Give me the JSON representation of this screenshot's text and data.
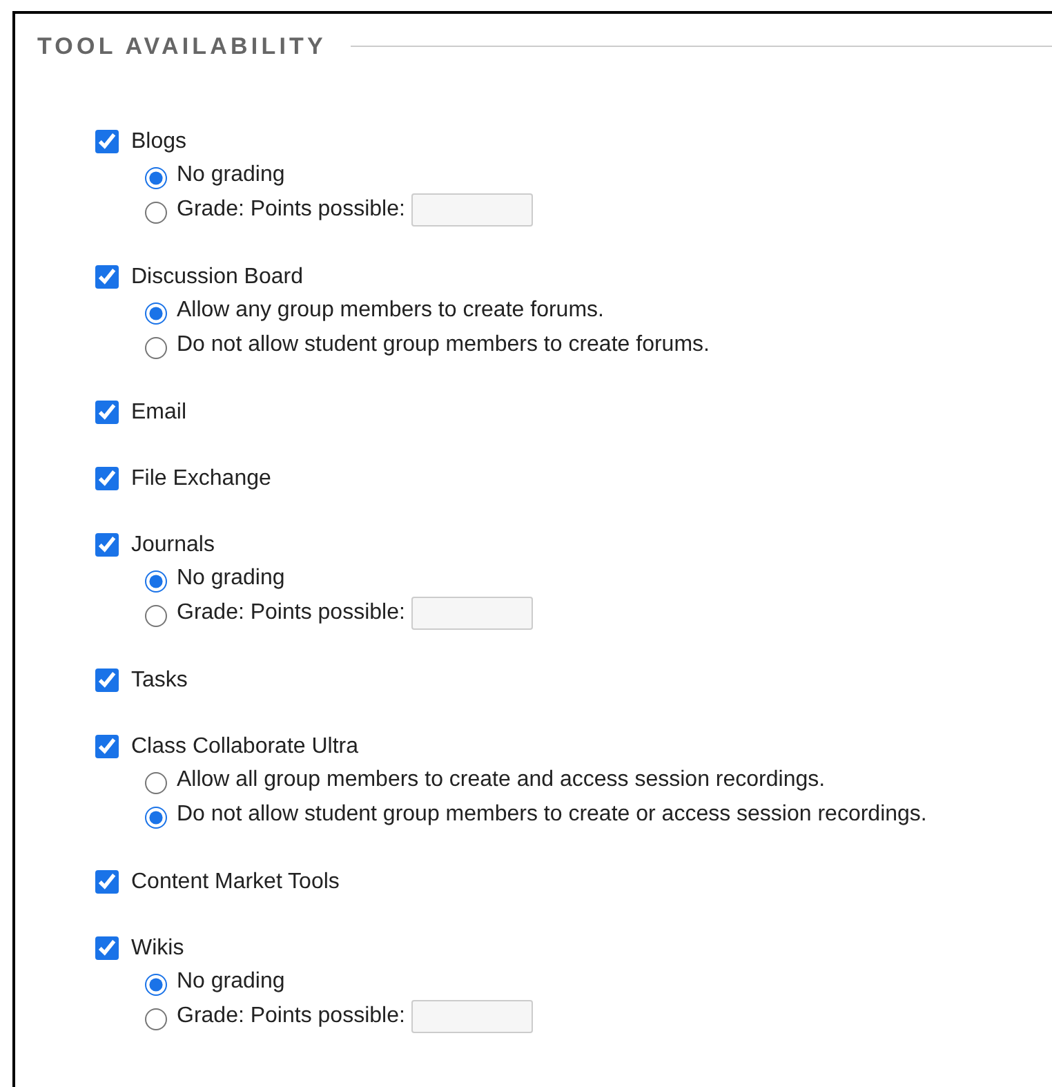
{
  "section": {
    "title": "TOOL AVAILABILITY"
  },
  "tools": [
    {
      "label": "Blogs",
      "checked": true,
      "options": [
        {
          "kind": "radio",
          "label": "No grading",
          "selected": true
        },
        {
          "kind": "points",
          "label": "Grade: Points possible:",
          "selected": false
        }
      ]
    },
    {
      "label": "Discussion Board",
      "checked": true,
      "options": [
        {
          "kind": "radio",
          "label": "Allow any group members to create forums.",
          "selected": true
        },
        {
          "kind": "radio",
          "label": "Do not allow student group members to create forums.",
          "selected": false
        }
      ]
    },
    {
      "label": "Email",
      "checked": true
    },
    {
      "label": "File Exchange",
      "checked": true
    },
    {
      "label": "Journals",
      "checked": true,
      "options": [
        {
          "kind": "radio",
          "label": "No grading",
          "selected": true
        },
        {
          "kind": "points",
          "label": "Grade: Points possible:",
          "selected": false
        }
      ]
    },
    {
      "label": "Tasks",
      "checked": true
    },
    {
      "label": "Class Collaborate Ultra",
      "checked": true,
      "options": [
        {
          "kind": "radio",
          "label": "Allow all group members to create and access session recordings.",
          "selected": false
        },
        {
          "kind": "radio",
          "label": "Do not allow student group members to create or access session recordings.",
          "selected": true
        }
      ]
    },
    {
      "label": "Content Market Tools",
      "checked": true
    },
    {
      "label": "Wikis",
      "checked": true,
      "options": [
        {
          "kind": "radio",
          "label": "No grading",
          "selected": true
        },
        {
          "kind": "points",
          "label": "Grade: Points possible:",
          "selected": false
        }
      ]
    }
  ]
}
